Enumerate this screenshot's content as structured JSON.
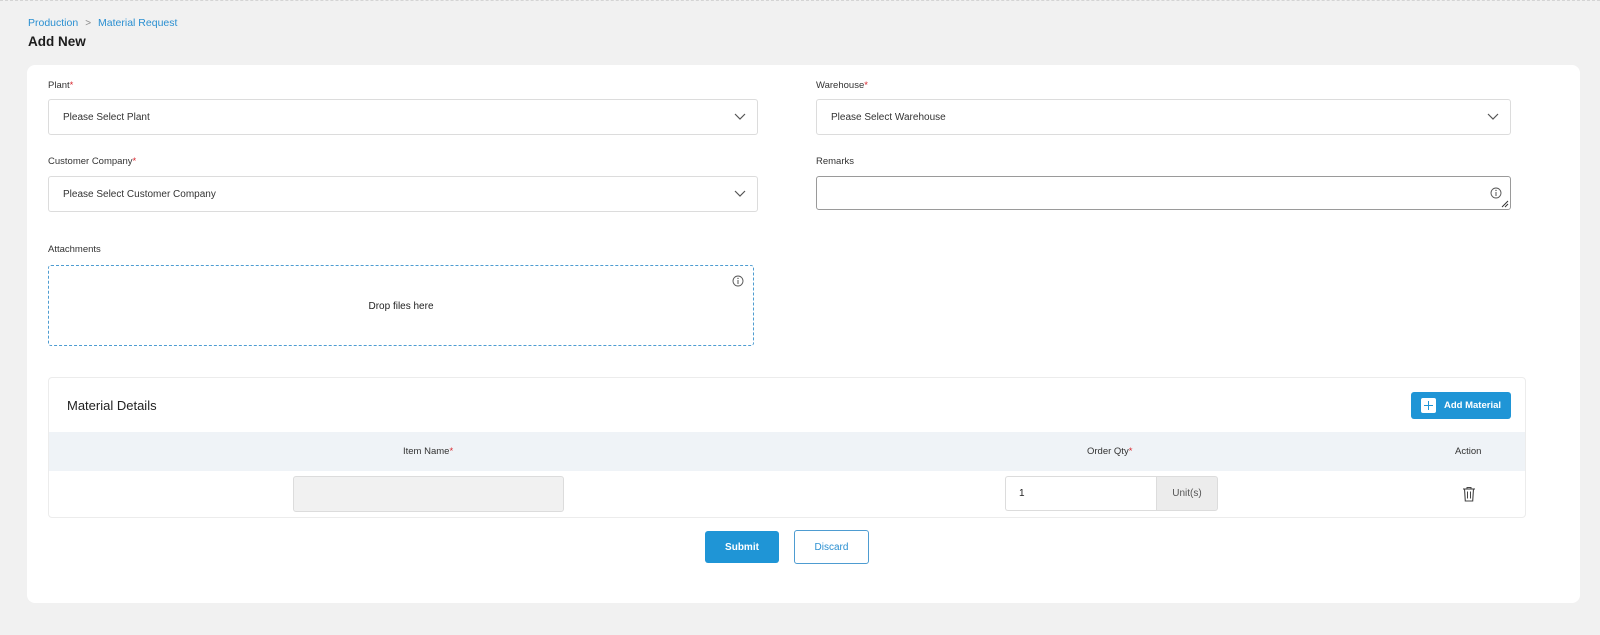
{
  "breadcrumb": {
    "items": [
      "Production",
      "Material Request"
    ],
    "separator": ">"
  },
  "page": {
    "title": "Add New"
  },
  "form": {
    "plant": {
      "label": "Plant",
      "required_mark": "*",
      "value": "Please Select Plant"
    },
    "warehouse": {
      "label": "Warehouse",
      "required_mark": "*",
      "value": "Please Select Warehouse"
    },
    "customer_company": {
      "label": "Customer Company",
      "required_mark": "*",
      "value": "Please Select Customer Company"
    },
    "remarks": {
      "label": "Remarks",
      "value": ""
    },
    "attachments": {
      "label": "Attachments",
      "dropzone_text": "Drop files here"
    }
  },
  "material_details": {
    "title": "Material Details",
    "add_button": "Add Material",
    "columns": {
      "item_name": "Item Name",
      "item_name_required": "*",
      "order_qty": "Order Qty",
      "order_qty_required": "*",
      "action": "Action"
    },
    "rows": [
      {
        "item_name": "",
        "order_qty": "1",
        "unit": "Unit(s)"
      }
    ]
  },
  "actions": {
    "submit": "Submit",
    "discard": "Discard"
  },
  "icons": {
    "dropdown": "chevron-down-icon",
    "info": "info-icon",
    "delete": "trash-icon",
    "add": "plus-icon"
  },
  "colors": {
    "accent": "#1f95d6",
    "link": "#2a8fd1",
    "required": "#d9272e",
    "background": "#f1f1f1"
  }
}
